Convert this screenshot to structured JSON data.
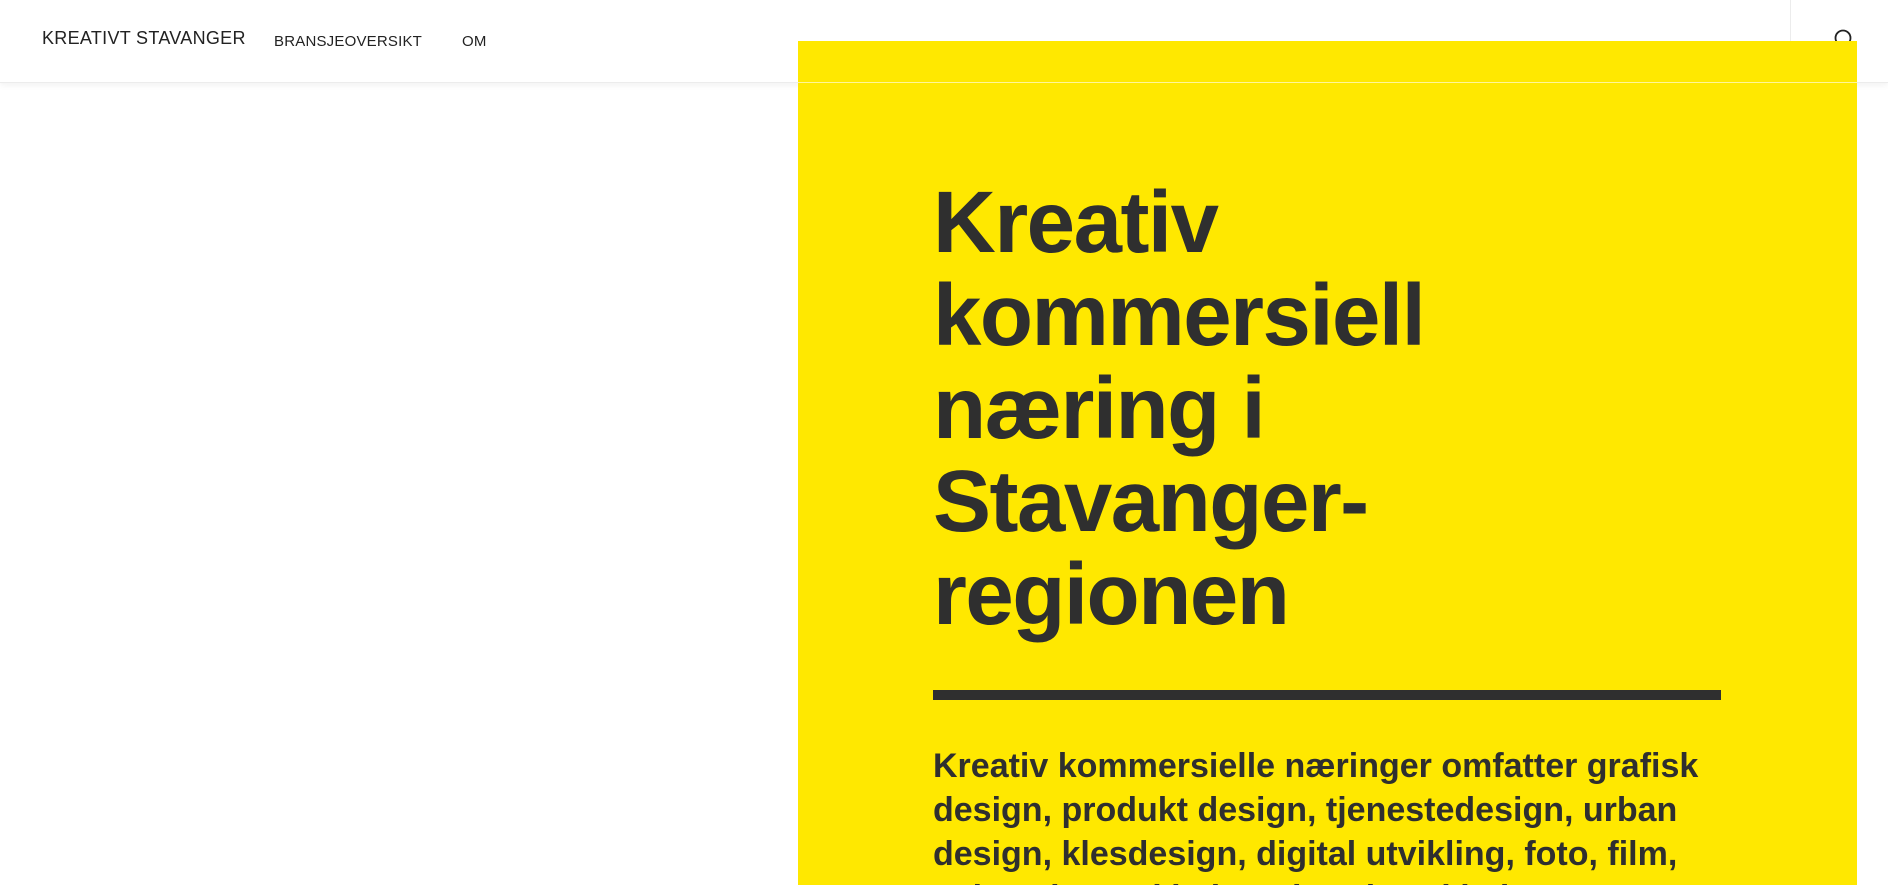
{
  "header": {
    "brand": "KREATIVT STAVANGER",
    "nav": [
      {
        "label": "BRANSJEOVERSIKT"
      },
      {
        "label": "OM"
      }
    ],
    "search_icon": "search-icon"
  },
  "hero": {
    "title": "Kreativ kommersiell næring i Stavanger-regionen",
    "lead": "Kreativ kommersielle næringer omfatter grafisk design, produkt design, tjenestedesign, urban design, klesdesign, digital utvikling, foto, film, animasjon, arkitektur, interiørarkitektur"
  },
  "colors": {
    "accent": "#ffe800",
    "text": "#2f2f2f",
    "background": "#ffffff"
  }
}
